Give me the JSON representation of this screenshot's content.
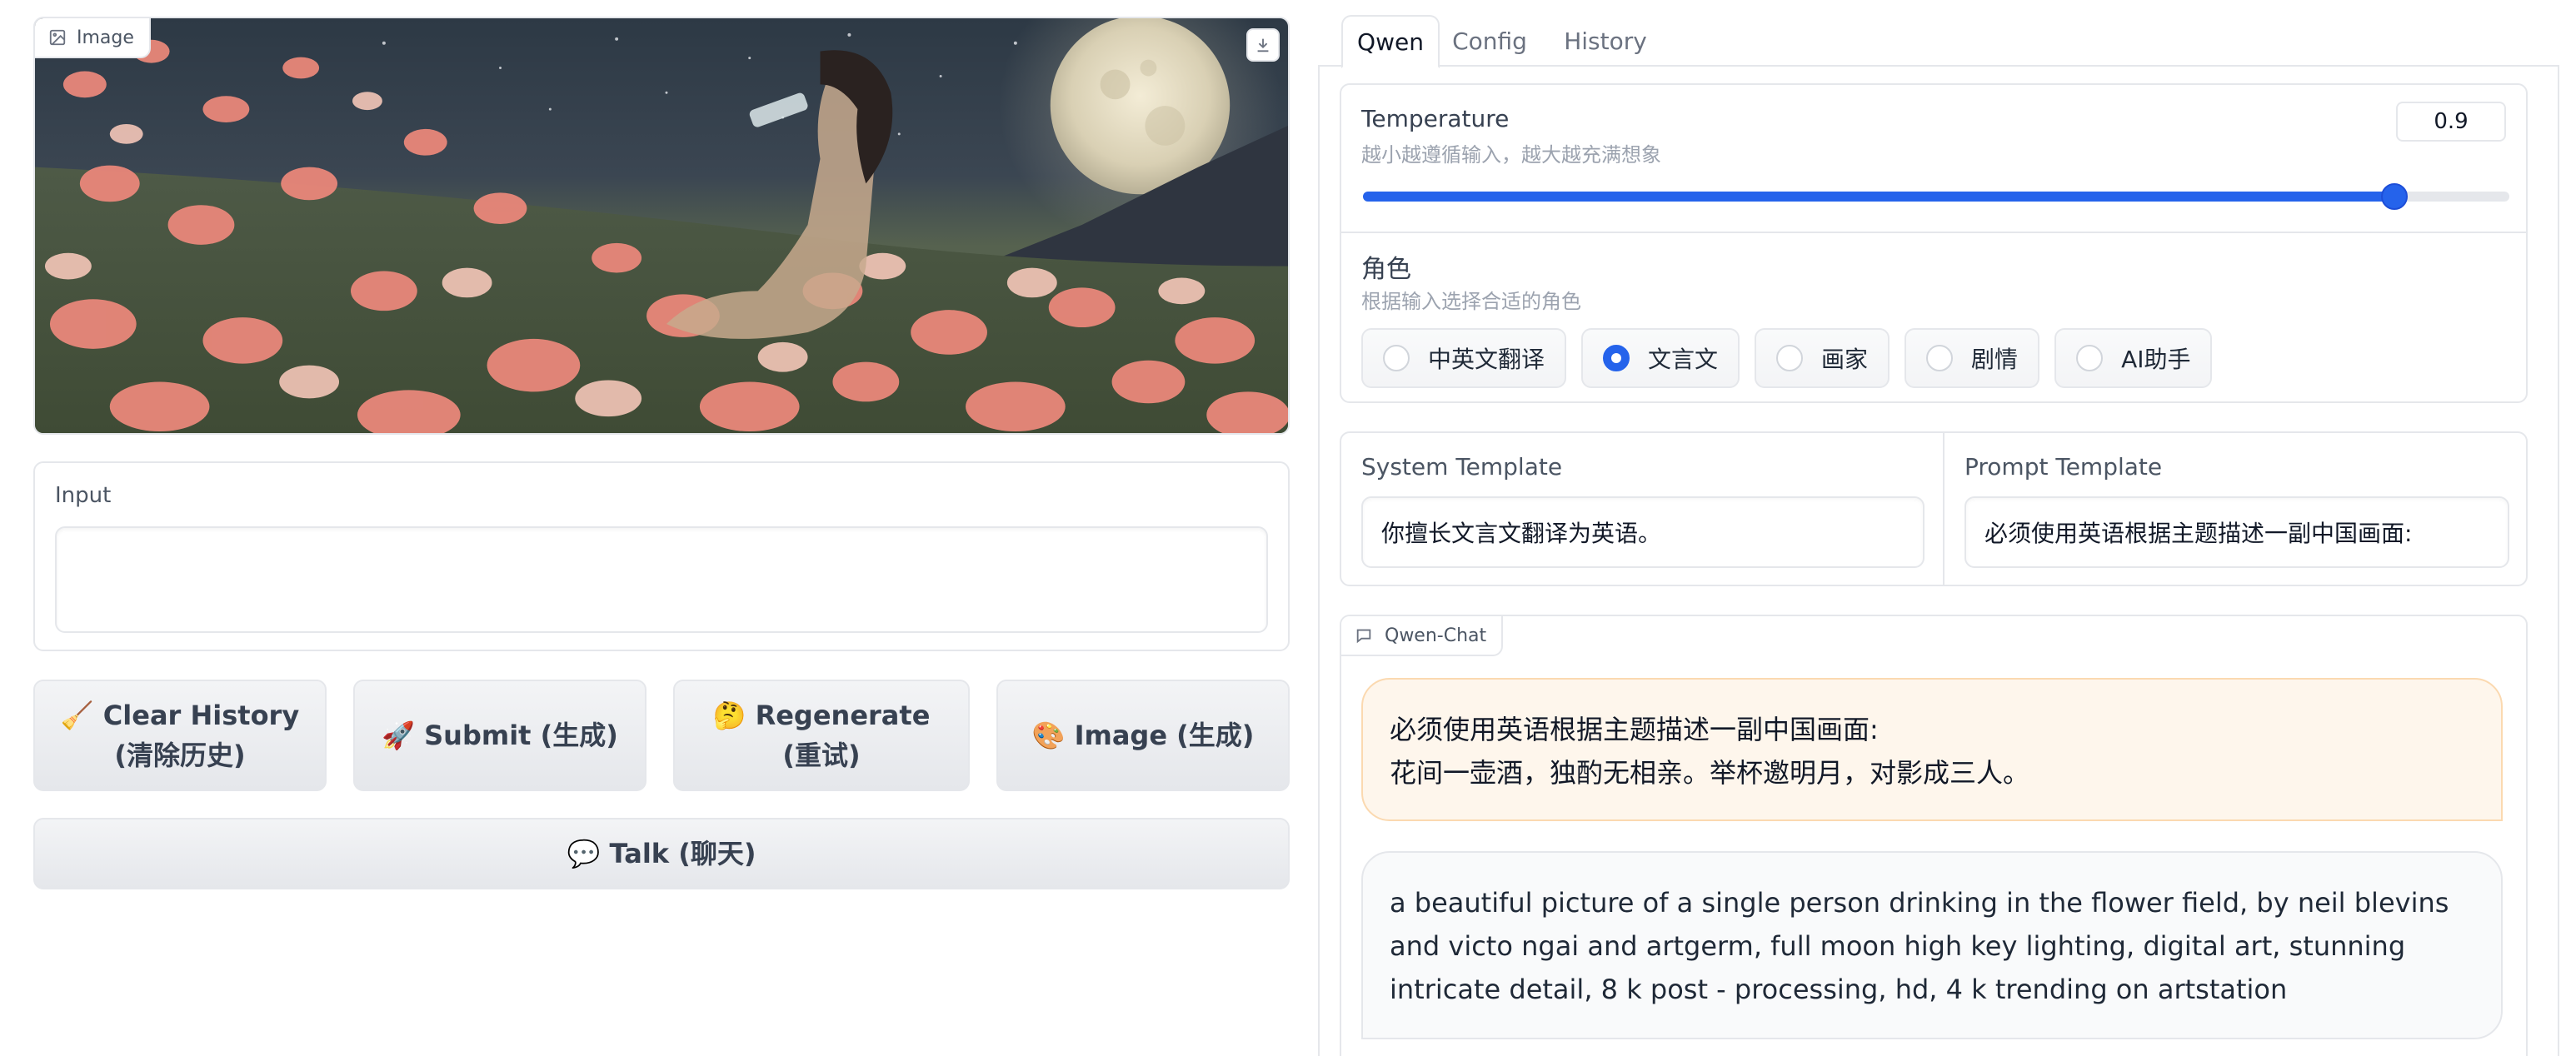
{
  "image_panel": {
    "label": "Image",
    "icons": {
      "label_icon": "image-icon",
      "download_icon": "download-icon"
    }
  },
  "input": {
    "label": "Input",
    "value": "",
    "placeholder": ""
  },
  "buttons": {
    "clear": "🧹 Clear History (清除历史)",
    "submit": "🚀 Submit (生成)",
    "regenerate": "🤔 Regenerate (重试)",
    "image": "🎨 Image (生成)",
    "talk": "💬 Talk (聊天)"
  },
  "tabs": [
    {
      "label": "Qwen",
      "active": true
    },
    {
      "label": "Config",
      "active": false
    },
    {
      "label": "History",
      "active": false
    }
  ],
  "temperature": {
    "label": "Temperature",
    "info": "越小越遵循输入，越大越充满想象",
    "value": "0.9",
    "slider_fraction": 0.9
  },
  "role": {
    "label": "角色",
    "info": "根据输入选择合适的角色",
    "options": [
      "中英文翻译",
      "文言文",
      "画家",
      "剧情",
      "AI助手"
    ],
    "selected": "文言文"
  },
  "templates": {
    "system_label": "System Template",
    "system_value": "你擅长文言文翻译为英语。",
    "prompt_label": "Prompt Template",
    "prompt_value": "必须使用英语根据主题描述一副中国画面:"
  },
  "chat": {
    "label": "Qwen-Chat",
    "user_message_line1": "必须使用英语根据主题描述一副中国画面:",
    "user_message_line2": "花间一壶酒，独酌无相亲。举杯邀明月，对影成三人。",
    "bot_message": "a beautiful picture of a single person drinking in the flower field, by neil blevins and victo ngai and artgerm, full moon high key lighting, digital art, stunning intricate detail, 8 k post - processing, hd, 4 k trending on artstation"
  },
  "colors": {
    "accent": "#2563eb",
    "user_bubble_bg": "#fef6ec",
    "user_bubble_border": "#fbd9b0",
    "bot_bubble_bg": "#f9fafb",
    "border": "#e5e7eb"
  }
}
